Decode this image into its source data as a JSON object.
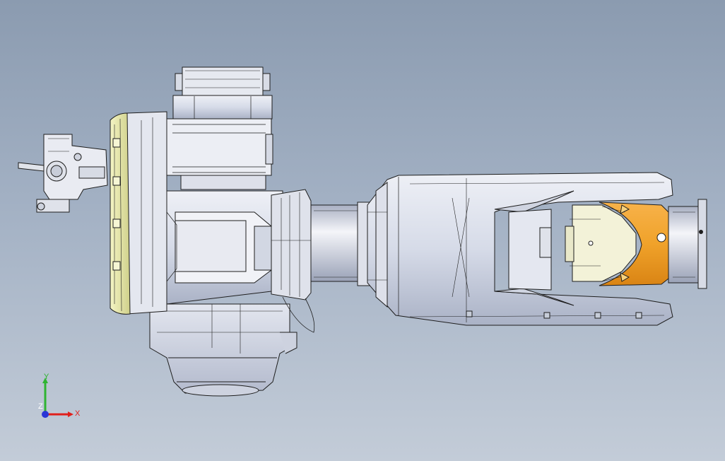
{
  "scene": {
    "colors": {
      "background_top": "#8b9bb0",
      "background_bottom": "#c3ccd8",
      "body_fill": "#d6dbe8",
      "body_shade": "#b9c0d2",
      "edge": "#1e1e1e",
      "flange_yellow": "#e6e79a",
      "end_effector_orange": "#f2a531",
      "joint_cream": "#f1f0d2"
    }
  },
  "triad": {
    "x_label": "X",
    "y_label": "Y",
    "z_label": "Z",
    "x_color": "#e0201c",
    "y_color": "#2fb432",
    "z_color": "#2a36d6"
  }
}
